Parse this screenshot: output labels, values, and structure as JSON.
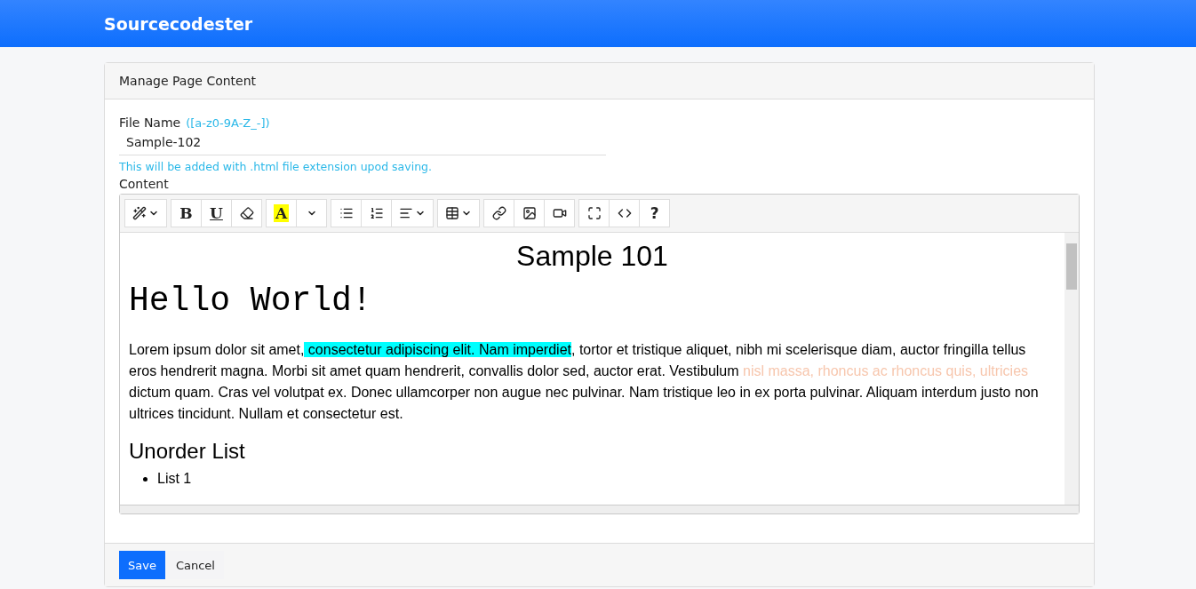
{
  "navbar": {
    "brand": "Sourcecodester"
  },
  "card": {
    "title": "Manage Page Content",
    "file_name": {
      "label": "File Name",
      "hint": "([a-z0-9A-Z_-])",
      "value": "Sample-102",
      "help": "This will be added with .html file extension upod saving."
    },
    "content_label": "Content",
    "toolbar": [
      [
        {
          "kind": "magic"
        }
      ],
      [
        {
          "kind": "bold",
          "label": "B"
        },
        {
          "kind": "underline",
          "label": "U"
        },
        {
          "kind": "eraser"
        }
      ],
      [
        {
          "kind": "color",
          "label": "A"
        },
        {
          "kind": "caret"
        }
      ],
      [
        {
          "kind": "ul"
        },
        {
          "kind": "ol"
        },
        {
          "kind": "align"
        }
      ],
      [
        {
          "kind": "table"
        }
      ],
      [
        {
          "kind": "link"
        },
        {
          "kind": "picture"
        },
        {
          "kind": "video"
        }
      ],
      [
        {
          "kind": "fullscreen"
        },
        {
          "kind": "code"
        },
        {
          "kind": "help",
          "label": "?"
        }
      ]
    ],
    "editor": {
      "title": "Sample 101",
      "heading": "Hello World!",
      "paragraph": [
        {
          "text": "Lorem ipsum dolor sit amet,"
        },
        {
          "text": " consectetur adipiscing elit. Nam imperdiet",
          "highlighted": true
        },
        {
          "text": ", tortor et tristique aliquet, nibh mi scelerisque diam, auctor fringilla tellus eros hendrerit magna. Morbi sit amet quam hendrerit, convallis dolor sed, auctor erat. Vestibulum "
        },
        {
          "text": "nisl massa, rhoncus ac rhoncus quis, ultricies",
          "color": "#f7c6ad"
        },
        {
          "text": " dictum quam. Cras vel volutpat ex. Donec ullamcorper non augue nec pulvinar. Nam tristique leo in ex porta pulvinar. Aliquam interdum justo non ultrices tincidunt. Nullam et consectetur est."
        }
      ],
      "subheading": "Unorder List",
      "list": [
        "List 1"
      ]
    },
    "buttons": [
      {
        "kind": "primary",
        "label": "Save"
      },
      {
        "kind": "secondary",
        "label": "Cancel"
      }
    ]
  }
}
